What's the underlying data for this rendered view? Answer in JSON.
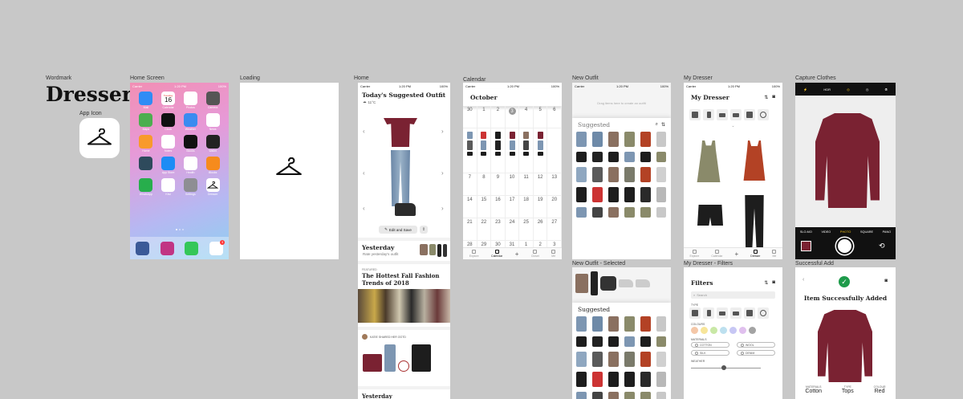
{
  "labels": {
    "wordmark": "Wordmark",
    "app_icon": "App Icon",
    "home_screen": "Home Screen",
    "loading": "Loading",
    "home": "Home",
    "calendar": "Calendar",
    "new_outfit": "New Outfit",
    "new_outfit_selected": "New Outfit - Selected",
    "my_dresser": "My Dresser",
    "my_dresser_filters": "My Dresser - Filters",
    "capture_clothes": "Capture Clothes",
    "successful_add": "Successful Add"
  },
  "wordmark_text": "Dresser",
  "status": {
    "carrier": "Carrier",
    "time": "1:20 PM",
    "battery": "100%"
  },
  "home_screen": {
    "calendar_day": "Tuesday",
    "calendar_date": "16",
    "apps": [
      "Mail",
      "Calendar",
      "Photos",
      "Camera",
      "Maps",
      "Clock",
      "Weather",
      "News",
      "Home",
      "Notes",
      "Stocks",
      "Wallet",
      "",
      "App Store",
      "Health",
      "iBooks",
      "WhatsApp",
      "Kiwi",
      "Settings",
      "Dresser"
    ],
    "app_colors": [
      "#2f8cf5",
      "#ffffff",
      "#ffffff",
      "#555555",
      "#4cae4f",
      "#111111",
      "#3b8bf0",
      "#ffffff",
      "#f89a2b",
      "#ffffff",
      "#111111",
      "#222222",
      "#2e4a5c",
      "#1d8cf5",
      "#ffffff",
      "#f68b1d",
      "#27ae4c",
      "#ffffff",
      "#8e8e93",
      "#ffffff"
    ],
    "dock": [
      "Facebook",
      "Instagram",
      "Messages",
      "Messenger"
    ],
    "dock_colors": [
      "#3b5998",
      "#c13584",
      "#34c759",
      "#ffffff"
    ],
    "badge": "3"
  },
  "home": {
    "title": "Today's Suggested Outfit",
    "weather": "11°C",
    "edit_save": "Edit and Save",
    "yesterday_title": "Yesterday",
    "yesterday_sub": "Rate yesterday's outfit",
    "featured_tag": "FEATURED",
    "featured_title": "The Hottest Fall Fashion Trends of 2018",
    "shared_by": "KATIE SHARED HER OOTD",
    "next_card": "Yesterday"
  },
  "calendar": {
    "month": "October",
    "row1": [
      "30",
      "1",
      "2",
      "3",
      "4",
      "5",
      "6"
    ],
    "row3": [
      "7",
      "8",
      "9",
      "10",
      "11",
      "12",
      "13"
    ],
    "row4": [
      "14",
      "15",
      "16",
      "17",
      "18",
      "19",
      "20"
    ],
    "row5": [
      "21",
      "22",
      "23",
      "24",
      "25",
      "26",
      "27"
    ],
    "row6": [
      "28",
      "29",
      "30",
      "31",
      "1",
      "2",
      "3"
    ],
    "tabs": [
      "Explore",
      "Calendar",
      "",
      "Closet",
      "Me"
    ]
  },
  "new_outfit": {
    "hint": "Drag items here to create an outfit",
    "suggested": "Suggested"
  },
  "new_outfit_selected": {
    "suggested": "Suggested"
  },
  "my_dresser": {
    "title": "My Dresser",
    "tabs": [
      "Explore",
      "Calendar",
      "",
      "Dresser",
      "Me"
    ]
  },
  "filters": {
    "title": "Filters",
    "search_placeholder": "Search",
    "type_label": "TYPE",
    "colours_label": "COLOURS",
    "materials_label": "MATERIALS",
    "weather_label": "WEATHER",
    "materials": [
      "COTTON",
      "WOOL",
      "SILK",
      "DENIM"
    ],
    "colours": [
      "#f4c7a8",
      "#f7e59a",
      "#c9e8a6",
      "#bde0ef",
      "#c7c7f4",
      "#e0c0ee",
      "#a3a3a3"
    ]
  },
  "capture": {
    "hdr": "HDR",
    "modes": [
      "SLO-MO",
      "VIDEO",
      "PHOTO",
      "SQUARE",
      "PANO"
    ]
  },
  "success": {
    "title": "Item Successfully Added",
    "materials_label": "MATERIALS",
    "materials_value": "Cotton",
    "type_label": "TYPE",
    "type_value": "Tops",
    "colour_label": "COLOUR",
    "colour_value": "Red"
  },
  "colors": {
    "burgundy": "#7a2232",
    "denim": "#7d96b2",
    "black": "#1d1d1d",
    "olive": "#8a8a6a",
    "rust": "#b34225",
    "grey": "#a8a8a8",
    "success_green": "#1e9b4b"
  }
}
